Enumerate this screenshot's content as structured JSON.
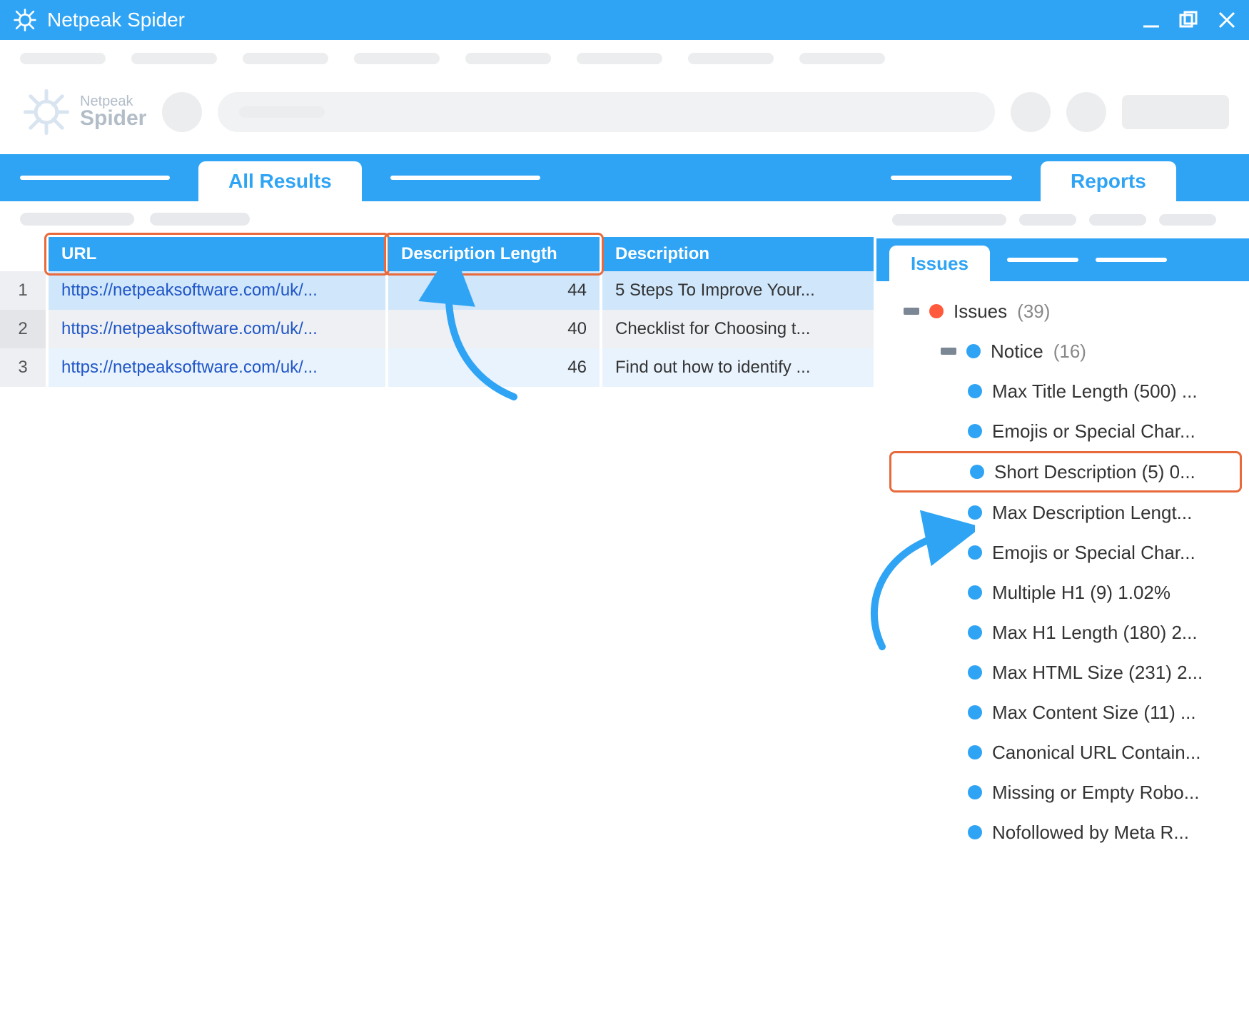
{
  "app": {
    "title": "Netpeak Spider"
  },
  "logo": {
    "line1": "Netpeak",
    "line2": "Spider"
  },
  "mainTabs": {
    "active": "All Results"
  },
  "table": {
    "headers": {
      "url": "URL",
      "dlen": "Description Length",
      "desc": "Description"
    },
    "rows": [
      {
        "idx": "1",
        "url": "https://netpeaksoftware.com/uk/...",
        "dlen": "44",
        "desc": "5 Steps To Improve Your..."
      },
      {
        "idx": "2",
        "url": "https://netpeaksoftware.com/uk/...",
        "dlen": "40",
        "desc": "Checklist for Choosing t..."
      },
      {
        "idx": "3",
        "url": "https://netpeaksoftware.com/uk/...",
        "dlen": "46",
        "desc": "Find out how to identify ..."
      }
    ]
  },
  "rightTabs": {
    "active": "Reports"
  },
  "subTabs": {
    "active": "Issues"
  },
  "tree": {
    "root": {
      "label": "Issues",
      "count": "(39)"
    },
    "group": {
      "label": "Notice",
      "count": "(16)"
    },
    "items": [
      {
        "label": "Max Title Length (500) ..."
      },
      {
        "label": "Emojis or Special Char..."
      },
      {
        "label": "Short Description (5) 0...",
        "highlight": true
      },
      {
        "label": "Max Description Lengt..."
      },
      {
        "label": "Emojis or Special Char..."
      },
      {
        "label": "Multiple H1 (9) 1.02%"
      },
      {
        "label": "Max H1 Length (180) 2..."
      },
      {
        "label": "Max HTML Size (231) 2..."
      },
      {
        "label": "Max Content Size (11) ..."
      },
      {
        "label": "Canonical URL Contain..."
      },
      {
        "label": "Missing or Empty Robo..."
      },
      {
        "label": "Nofollowed by Meta R..."
      }
    ]
  }
}
